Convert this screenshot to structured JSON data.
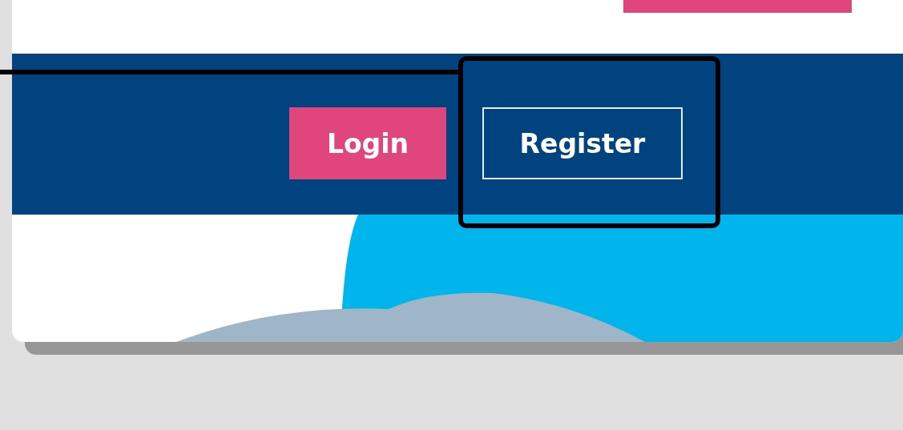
{
  "nav_buttons": [
    {
      "label": "Login",
      "kind": "filled",
      "highlighted": false
    },
    {
      "label": "Register",
      "kind": "outlined",
      "highlighted": true
    }
  ]
}
